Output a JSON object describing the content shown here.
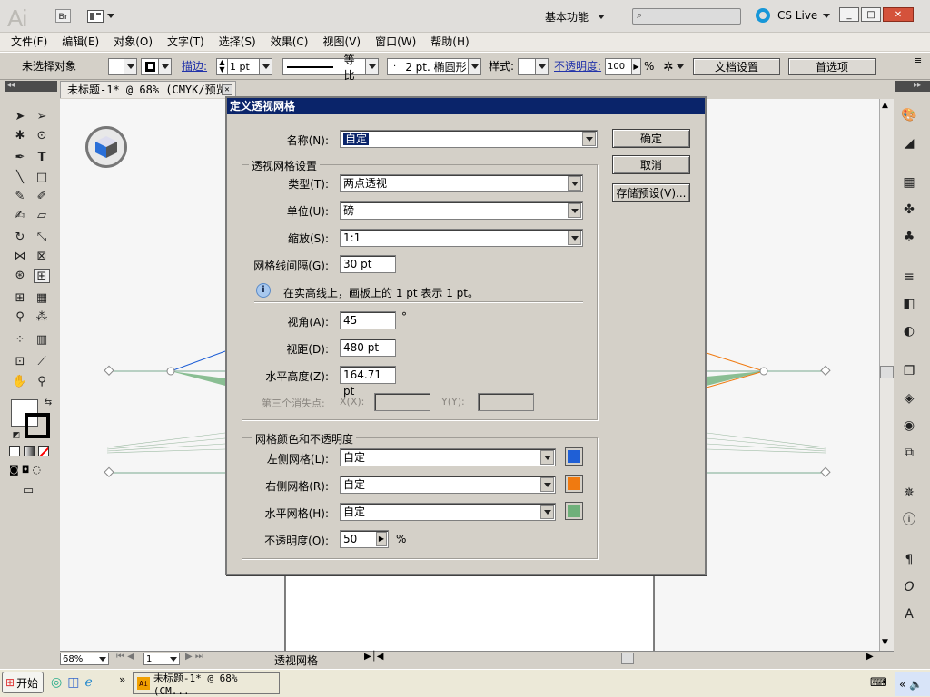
{
  "app": {
    "logo": "Ai",
    "bridge": "Br",
    "workspace": "基本功能",
    "cs_live": "CS Live",
    "window_buttons": [
      "_",
      "□",
      "✕"
    ]
  },
  "menu": [
    "文件(F)",
    "编辑(E)",
    "对象(O)",
    "文字(T)",
    "选择(S)",
    "效果(C)",
    "视图(V)",
    "窗口(W)",
    "帮助(H)"
  ],
  "control_bar": {
    "no_selection": "未选择对象",
    "stroke_label": "描边:",
    "stroke_value": "1 pt",
    "stroke_style": "等比",
    "brush": "2 pt. 椭圆形",
    "style_label": "样式:",
    "opacity_label": "不透明度:",
    "opacity_value": "100",
    "percent": "%",
    "doc_settings": "文档设置",
    "preferences": "首选项"
  },
  "document": {
    "tab": "未标题-1* @ 68% (CMYK/预览)",
    "zoom": "68%",
    "artboard": "1",
    "status": "透视网格"
  },
  "taskbar": {
    "start": "开始",
    "task": "未标题-1* @ 68% (CM..."
  },
  "dialog": {
    "title": "定义透视网格",
    "name_label": "名称(N):",
    "name_value": "自定",
    "ok": "确定",
    "cancel": "取消",
    "save_preset": "存储预设(V)...",
    "grid_settings_group": "透视网格设置",
    "type_label": "类型(T):",
    "type_value": "两点透视",
    "unit_label": "单位(U):",
    "unit_value": "磅",
    "scale_label": "缩放(S):",
    "scale_value": "1:1",
    "gridline_label": "网格线间隔(G):",
    "gridline_value": "30 pt",
    "info_text": "在实高线上，画板上的 1 pt 表示 1 pt。",
    "angle_label": "视角(A):",
    "angle_value": "45",
    "degree": "°",
    "distance_label": "视距(D):",
    "distance_value": "480 pt",
    "horizon_label": "水平高度(Z):",
    "horizon_value": "164.71 pt",
    "third_vp_label": "第三个消失点:",
    "x_label": "X(X):",
    "y_label": "Y(Y):",
    "color_group": "网格颜色和不透明度",
    "left_grid_label": "左侧网格(L):",
    "left_grid_value": "自定",
    "left_grid_color": "#1f5fd6",
    "right_grid_label": "右侧网格(R):",
    "right_grid_value": "自定",
    "right_grid_color": "#f07a10",
    "horizontal_grid_label": "水平网格(H):",
    "horizontal_grid_value": "自定",
    "horizontal_grid_color": "#6fb07a",
    "opacity_label": "不透明度(O):",
    "opacity_value": "50",
    "percent": "%"
  }
}
